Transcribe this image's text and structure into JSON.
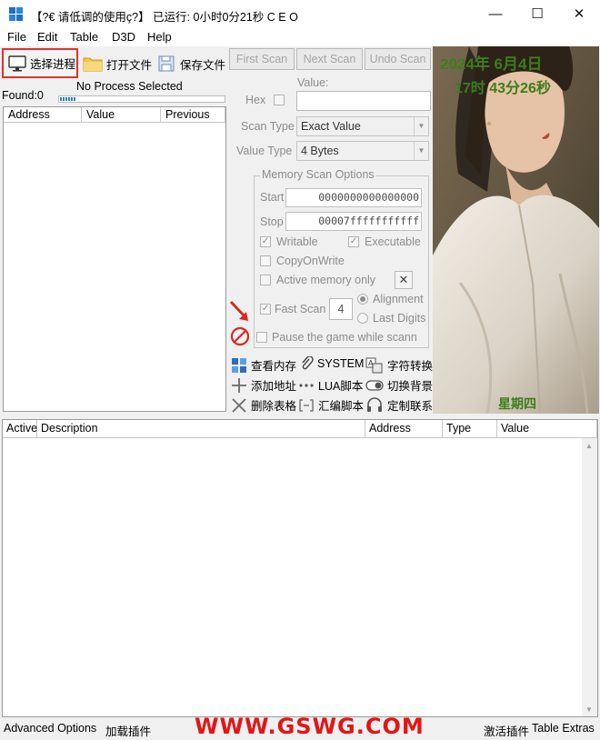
{
  "window": {
    "title": "【?€ 请低调的使用ç?】 已运行: 0小时0分21秒  C E O",
    "controls": {
      "minimize": "—",
      "maximize": "☐",
      "close": "✕"
    }
  },
  "menu": [
    "File",
    "Edit",
    "Table",
    "D3D",
    "Help"
  ],
  "toolbar": {
    "select_process": "选择进程",
    "open_file": "打开文件",
    "save_file": "保存文件"
  },
  "scan_buttons": {
    "first": "First Scan",
    "next": "Next Scan",
    "undo": "Undo Scan"
  },
  "found": {
    "label": "Found:",
    "count": "0"
  },
  "process_status": "No Process Selected",
  "progress": {
    "fraction": 0.1
  },
  "results_list": {
    "columns": [
      "Address",
      "Value",
      "Previous"
    ]
  },
  "scan_options": {
    "value_label": "Value:",
    "hex_label": "Hex",
    "scan_type_label": "Scan Type",
    "scan_type_value": "Exact Value",
    "value_type_label": "Value Type",
    "value_type_value": "4 Bytes",
    "memory_group_title": "Memory Scan Options",
    "start_label": "Start",
    "start_value": "0000000000000000",
    "stop_label": "Stop",
    "stop_value": "00007fffffffffff",
    "writable": "Writable",
    "executable": "Executable",
    "copy_on_write": "CopyOnWrite",
    "active_memory_only": "Active memory only",
    "fast_scan": "Fast Scan",
    "fast_scan_value": "4",
    "alignment": "Alignment",
    "last_digits": "Last Digits",
    "pause_game": "Pause the game while scann"
  },
  "plugins": {
    "view_memory": "查看内存",
    "system": "SYSTEM",
    "char_convert": "字符转换",
    "add_address": "添加地址",
    "lua_script": "LUA脚本",
    "switch_background": "切换背景",
    "delete_table": "删除表格",
    "asm_script": "汇编脚本",
    "custom_contact": "定制联系"
  },
  "photo_overlay": {
    "date": "2024年 6月4日",
    "time": "17时 43分26秒",
    "weekday": "星期四"
  },
  "address_table": {
    "columns": [
      "Active",
      "Description",
      "Address",
      "Type",
      "Value"
    ]
  },
  "status_bar": {
    "advanced_options": "Advanced Options",
    "load_plugin": "加载插件",
    "activate_plugin": "激活插件",
    "table_extras": "Table Extras",
    "watermark": "WWW.GSWG.COM"
  },
  "colors": {
    "highlight_border": "#d9352a",
    "clock_text": "#3c7d1a",
    "watermark": "#e41515"
  }
}
